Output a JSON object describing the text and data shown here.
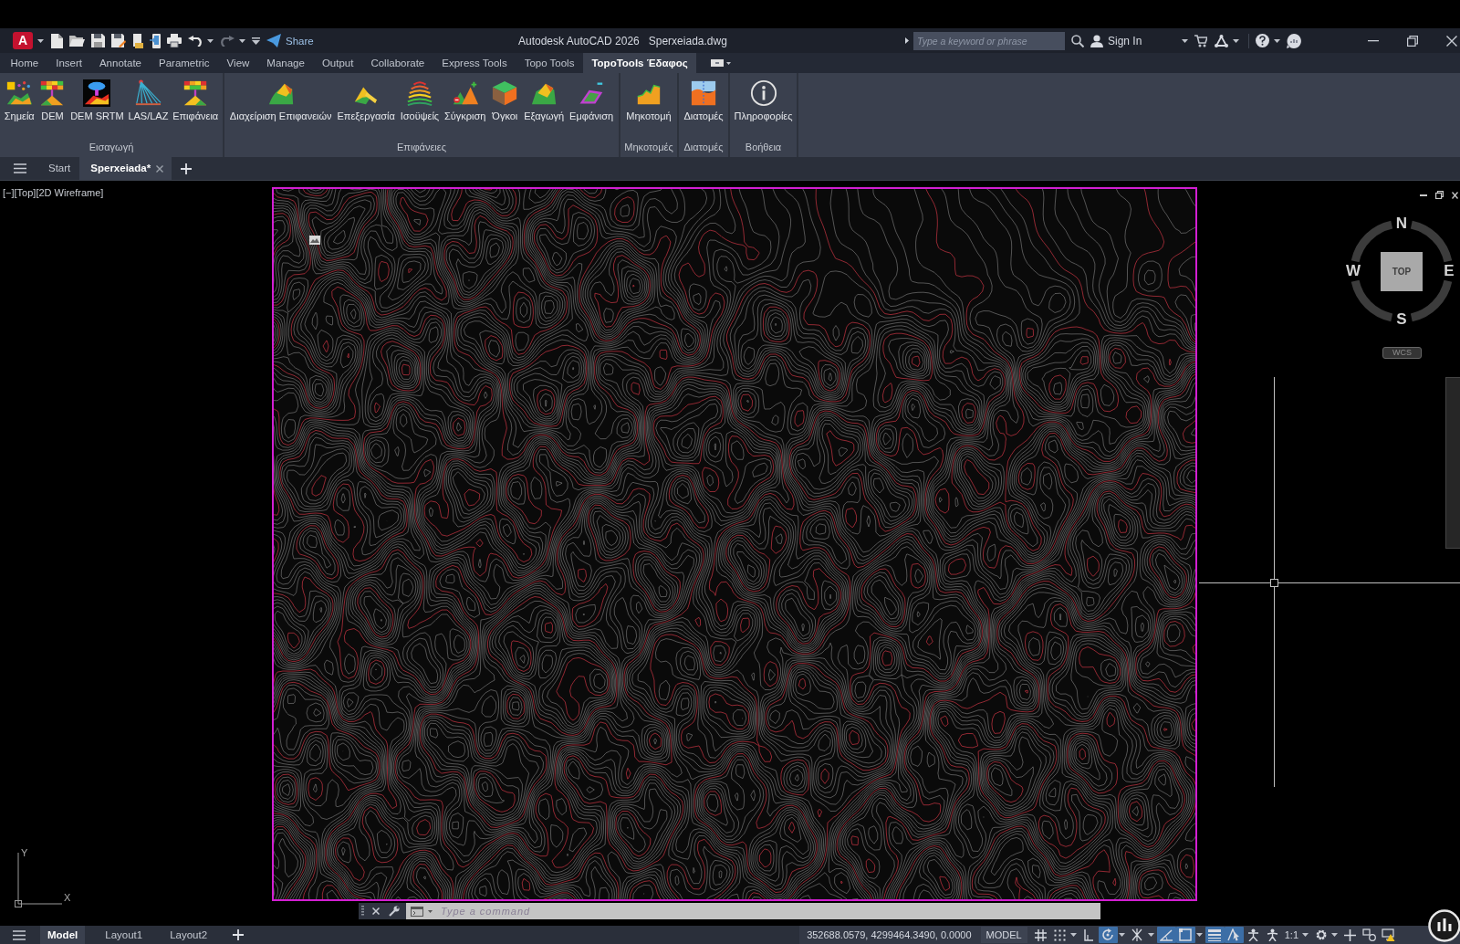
{
  "title_bar": {
    "logo": "A",
    "share": "Share",
    "app_title": "Autodesk AutoCAD 2026",
    "file_name": "Sperxeiada.dwg",
    "search": {
      "placeholder": "Type a keyword or phrase"
    },
    "sign_in": "Sign In"
  },
  "ribbon_tabs": [
    {
      "label": "Home",
      "selected": false
    },
    {
      "label": "Insert",
      "selected": false
    },
    {
      "label": "Annotate",
      "selected": false
    },
    {
      "label": "Parametric",
      "selected": false
    },
    {
      "label": "View",
      "selected": false
    },
    {
      "label": "Manage",
      "selected": false
    },
    {
      "label": "Output",
      "selected": false
    },
    {
      "label": "Collaborate",
      "selected": false
    },
    {
      "label": "Express Tools",
      "selected": false
    },
    {
      "label": "Topo Tools",
      "selected": false
    },
    {
      "label": "TopoTools Έδαφος",
      "selected": true
    }
  ],
  "ribbon_panels": [
    {
      "title": "Εισαγωγή",
      "buttons": [
        {
          "label": "Σημεία",
          "kind": "points"
        },
        {
          "label": "DEM",
          "kind": "dem"
        },
        {
          "label": "DEM SRTM",
          "kind": "srtm"
        },
        {
          "label": "LAS/LAZ",
          "kind": "lidar"
        },
        {
          "label": "Επιφάνεια",
          "kind": "surface"
        }
      ]
    },
    {
      "title": "Επιφάνειες",
      "buttons": [
        {
          "label": "Διαχείριση Επιφανειών",
          "kind": "manage"
        },
        {
          "label": "Επεξεργασία",
          "kind": "edit"
        },
        {
          "label": "Ισοϋψείς",
          "kind": "contours"
        },
        {
          "label": "Σύγκριση",
          "kind": "compare"
        },
        {
          "label": "Όγκοι",
          "kind": "volumes"
        },
        {
          "label": "Εξαγωγή",
          "kind": "export"
        },
        {
          "label": "Εμφάνιση",
          "kind": "display"
        }
      ]
    },
    {
      "title": "Μηκοτομές",
      "buttons": [
        {
          "label": "Μηκοτομή",
          "kind": "profile"
        }
      ]
    },
    {
      "title": "Διατομές",
      "buttons": [
        {
          "label": "Διατομές",
          "kind": "sections"
        }
      ]
    },
    {
      "title": "Βοήθεια",
      "buttons": [
        {
          "label": "Πληροφορίες",
          "kind": "info"
        }
      ]
    }
  ],
  "file_tabs": [
    {
      "label": "Start",
      "selected": false
    },
    {
      "label": "Sperxeiada*",
      "selected": true
    }
  ],
  "viewport": {
    "label": "[−][Top][2D Wireframe]",
    "viewcube": {
      "face": "TOP",
      "north": "N",
      "south": "S",
      "west": "W",
      "east": "E",
      "ucs_menu": "WCS"
    },
    "ucs": {
      "y": "Y",
      "x": "X"
    }
  },
  "command_line": {
    "placeholder": "Type a command"
  },
  "layout_tabs": [
    {
      "label": "Model",
      "selected": true
    },
    {
      "label": "Layout1",
      "selected": false
    },
    {
      "label": "Layout2",
      "selected": false
    }
  ],
  "status_bar": {
    "coordinates": "352688.0579, 4299464.3490, 0.0000",
    "space": "MODEL",
    "toggles": [
      {
        "kind": "grid",
        "on": false,
        "dropdown": false
      },
      {
        "kind": "snap",
        "on": false,
        "dropdown": true
      },
      {
        "kind": "ortho",
        "on": false,
        "dropdown": false
      },
      {
        "kind": "polar",
        "on": true,
        "dropdown": true
      },
      {
        "kind": "isodraft",
        "on": false,
        "dropdown": true
      },
      {
        "kind": "tracking",
        "on": true,
        "dropdown": false
      },
      {
        "kind": "osnap",
        "on": true,
        "dropdown": true
      },
      {
        "kind": "lineweight",
        "on": true,
        "dropdown": false
      },
      {
        "kind": "selection",
        "on": true,
        "dropdown": false
      },
      {
        "kind": "annovis",
        "on": false,
        "dropdown": false
      },
      {
        "kind": "annoscale",
        "on": false,
        "dropdown": false
      },
      {
        "kind": "scale",
        "label": "1:1",
        "on": false,
        "dropdown": true
      },
      {
        "kind": "workspace",
        "on": false,
        "dropdown": true
      },
      {
        "kind": "plus",
        "on": false,
        "dropdown": false
      },
      {
        "kind": "isolate",
        "on": false,
        "dropdown": false
      },
      {
        "kind": "hardware",
        "on": false,
        "dropdown": false
      }
    ]
  }
}
